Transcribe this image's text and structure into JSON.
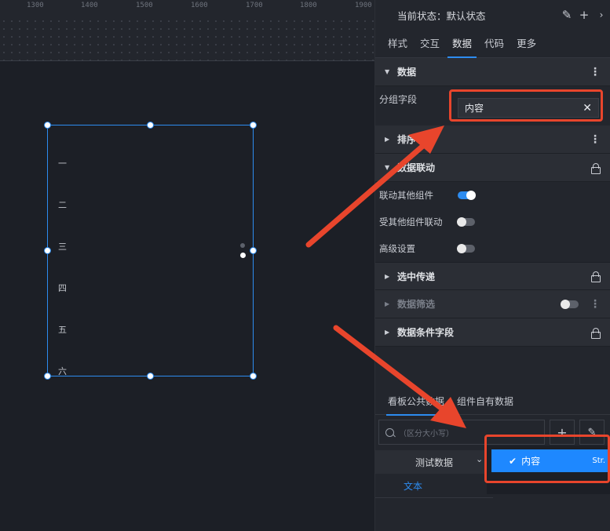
{
  "ruler": {
    "ticks": [
      "1300",
      "1400",
      "1500",
      "1600",
      "1700",
      "1800",
      "1900"
    ]
  },
  "canvas": {
    "list_items": [
      "一",
      "二",
      "三",
      "四",
      "五",
      "六"
    ]
  },
  "panel": {
    "state_label": "当前状态：",
    "state_value": "默认状态",
    "tabs": [
      "样式",
      "交互",
      "数据",
      "代码",
      "更多"
    ],
    "active_tab": "数据",
    "sections": {
      "data": {
        "title": "数据",
        "group_field_label": "分组字段",
        "group_field_value": "内容"
      },
      "sort": {
        "title": "排序"
      },
      "linkage": {
        "title": "数据联动",
        "link_others": "联动其他组件",
        "linked_by_others": "受其他组件联动",
        "advanced": "高级设置"
      },
      "selected_pass": {
        "title": "选中传递"
      },
      "data_filter": {
        "title": "数据筛选"
      },
      "condition_fields": {
        "title": "数据条件字段"
      }
    },
    "lower_tabs": [
      "看板公共数据",
      "组件自有数据"
    ],
    "search_placeholder": "（区分大小写）",
    "dataset_name": "测试数据",
    "dataset_field": "文本",
    "dropdown_option": "内容",
    "dropdown_type": "Str."
  },
  "colors": {
    "accent": "#2d8cf0",
    "annotation": "#e8452c",
    "option_bg": "#1e88ff"
  }
}
